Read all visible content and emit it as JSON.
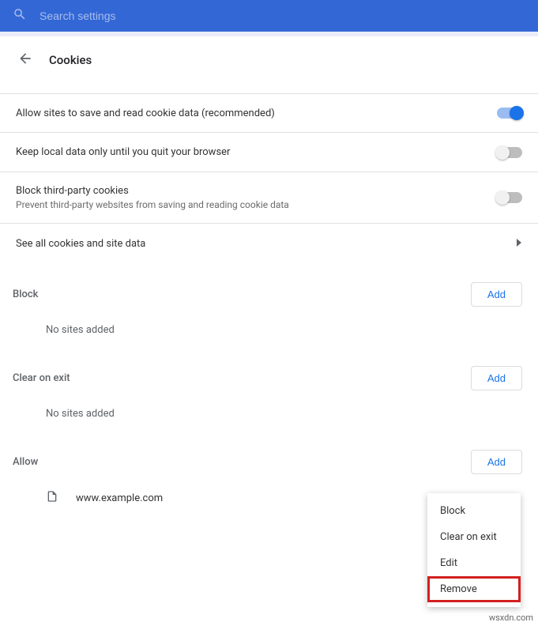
{
  "search": {
    "placeholder": "Search settings"
  },
  "header": {
    "title": "Cookies"
  },
  "settings": {
    "allow_cookies": {
      "label": "Allow sites to save and read cookie data (recommended)",
      "on": true
    },
    "keep_local": {
      "label": "Keep local data only until you quit your browser",
      "on": false
    },
    "block_third_party": {
      "label": "Block third-party cookies",
      "sub": "Prevent third-party websites from saving and reading cookie data",
      "on": false
    },
    "see_all": {
      "label": "See all cookies and site data"
    }
  },
  "sections": {
    "block": {
      "title": "Block",
      "add": "Add",
      "empty": "No sites added"
    },
    "clear_on_exit": {
      "title": "Clear on exit",
      "add": "Add",
      "empty": "No sites added"
    },
    "allow": {
      "title": "Allow",
      "add": "Add",
      "sites": [
        {
          "url": "www.example.com"
        }
      ]
    }
  },
  "context_menu": {
    "block": "Block",
    "clear_on_exit": "Clear on exit",
    "edit": "Edit",
    "remove": "Remove"
  },
  "watermark": "wsxdn.com"
}
